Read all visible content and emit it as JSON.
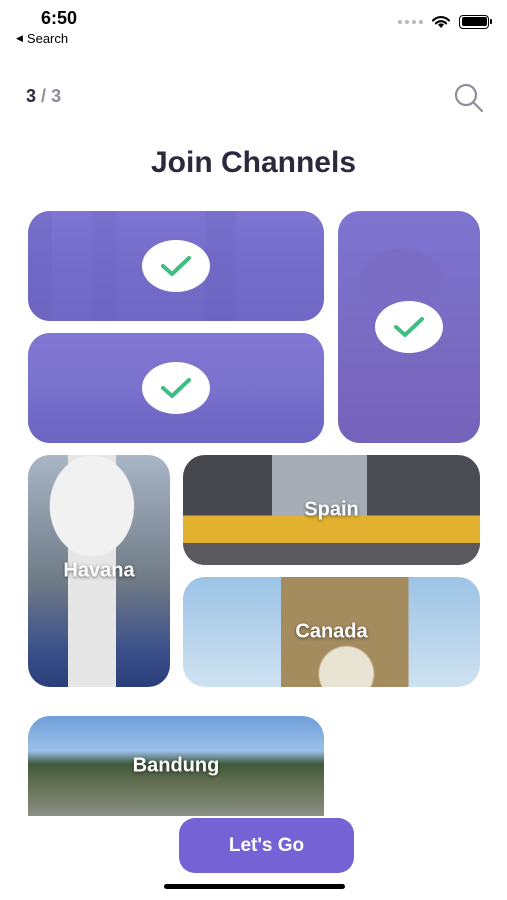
{
  "status": {
    "time": "6:50",
    "back_label": "Search"
  },
  "header": {
    "page_current": "3",
    "page_sep": "/",
    "page_total": "3"
  },
  "title": "Join Channels",
  "tiles": [
    {
      "id": "t1",
      "label": "",
      "selected": true
    },
    {
      "id": "t2",
      "label": "",
      "selected": true
    },
    {
      "id": "t3",
      "label": "",
      "selected": true
    },
    {
      "id": "t4",
      "label": "Havana",
      "selected": false
    },
    {
      "id": "t5",
      "label": "Spain",
      "selected": false
    },
    {
      "id": "t6",
      "label": "Canada",
      "selected": false
    },
    {
      "id": "t7",
      "label": "Bandung",
      "selected": false
    }
  ],
  "cta": {
    "label": "Let's Go"
  },
  "icons": {
    "search": "search-icon",
    "check": "checkmark-icon",
    "wifi": "wifi-icon",
    "battery": "battery-icon"
  },
  "colors": {
    "accent": "#7563d6",
    "check": "#3fbd82",
    "title": "#2b2a3d"
  }
}
